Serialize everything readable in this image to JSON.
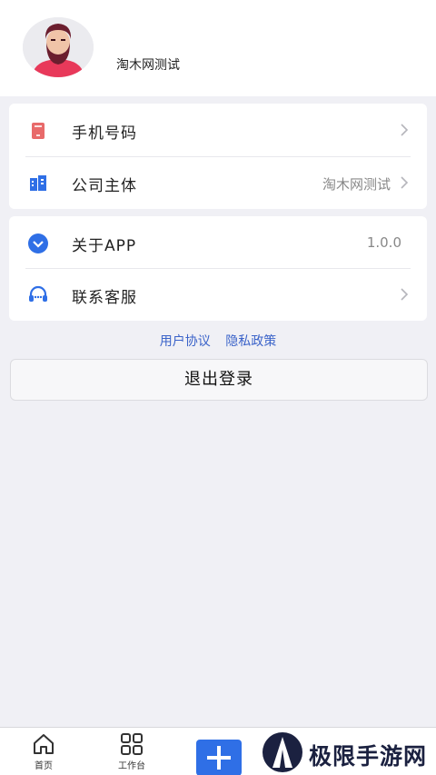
{
  "profile": {
    "name": "淘木网测试"
  },
  "menu_group_1": {
    "items": [
      {
        "label": "手机号码",
        "value": "",
        "icon": "phone-book-icon",
        "icon_color": "#e86a6a"
      },
      {
        "label": "公司主体",
        "value": "淘木网测试",
        "icon": "building-icon",
        "icon_color": "#2f6fe6"
      }
    ]
  },
  "menu_group_2": {
    "items": [
      {
        "label": "关于APP",
        "value": "1.0.0",
        "icon": "chevron-circle-icon",
        "icon_color": "#2f6fe6"
      },
      {
        "label": "联系客服",
        "value": "",
        "icon": "headset-icon",
        "icon_color": "#2f6fe6"
      }
    ]
  },
  "links": {
    "user_agreement": "用户协议",
    "privacy_policy": "隐私政策"
  },
  "logout": {
    "label": "退出登录"
  },
  "tabbar": {
    "home_label": "首页",
    "workbench_label": "工作台"
  },
  "watermark": {
    "text": "极限手游网"
  },
  "colors": {
    "accent": "#2f6fe6",
    "link": "#3b63c9",
    "background": "#f0f0f5"
  }
}
